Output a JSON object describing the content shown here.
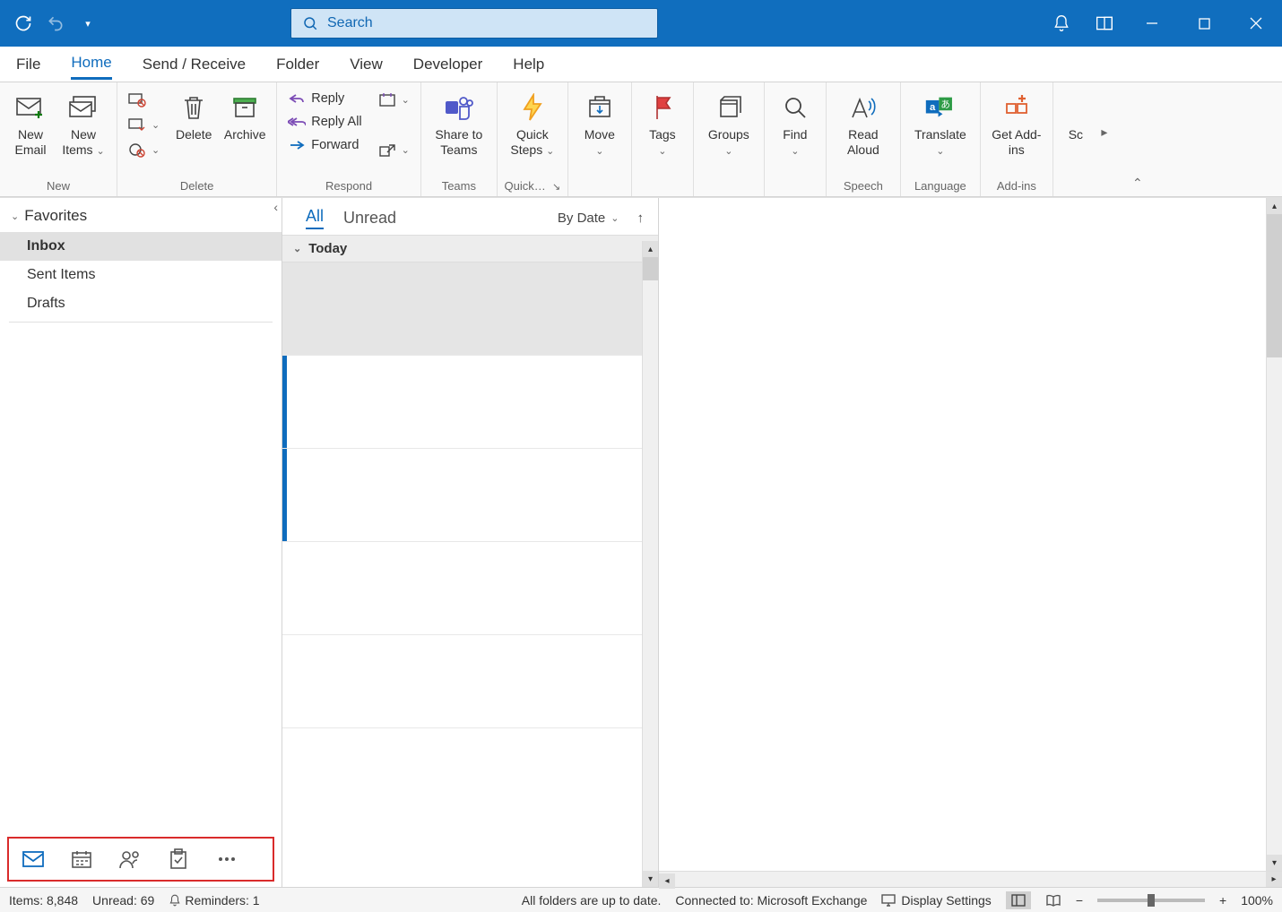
{
  "titlebar": {
    "search_placeholder": "Search"
  },
  "tabs": {
    "file": "File",
    "home": "Home",
    "sendreceive": "Send / Receive",
    "folder": "Folder",
    "view": "View",
    "developer": "Developer",
    "help": "Help"
  },
  "ribbon": {
    "new": {
      "new_email": "New Email",
      "new_items": "New Items",
      "group_label": "New"
    },
    "delete": {
      "delete": "Delete",
      "archive": "Archive",
      "group_label": "Delete"
    },
    "respond": {
      "reply": "Reply",
      "reply_all": "Reply All",
      "forward": "Forward",
      "group_label": "Respond"
    },
    "teams": {
      "share_to_teams": "Share to Teams",
      "group_label": "Teams"
    },
    "quicksteps": {
      "quick_steps": "Quick Steps",
      "group_label": "Quick…"
    },
    "move": {
      "label": "Move"
    },
    "tags": {
      "label": "Tags"
    },
    "groups": {
      "label": "Groups"
    },
    "find": {
      "label": "Find"
    },
    "speech": {
      "read_aloud": "Read Aloud",
      "group_label": "Speech"
    },
    "language": {
      "translate": "Translate",
      "group_label": "Language"
    },
    "addins": {
      "get_addins": "Get Add-ins",
      "group_label": "Add-ins"
    },
    "overflow": "Sc"
  },
  "nav": {
    "favorites": "Favorites",
    "inbox": "Inbox",
    "sent_items": "Sent Items",
    "drafts": "Drafts"
  },
  "messagelist": {
    "all": "All",
    "unread": "Unread",
    "sort": "By Date",
    "today": "Today"
  },
  "statusbar": {
    "items": "Items: 8,848",
    "unread": "Unread: 69",
    "reminders": "Reminders: 1",
    "folders_uptodate": "All folders are up to date.",
    "connected": "Connected to: Microsoft Exchange",
    "display_settings": "Display Settings",
    "zoom": "100%"
  }
}
